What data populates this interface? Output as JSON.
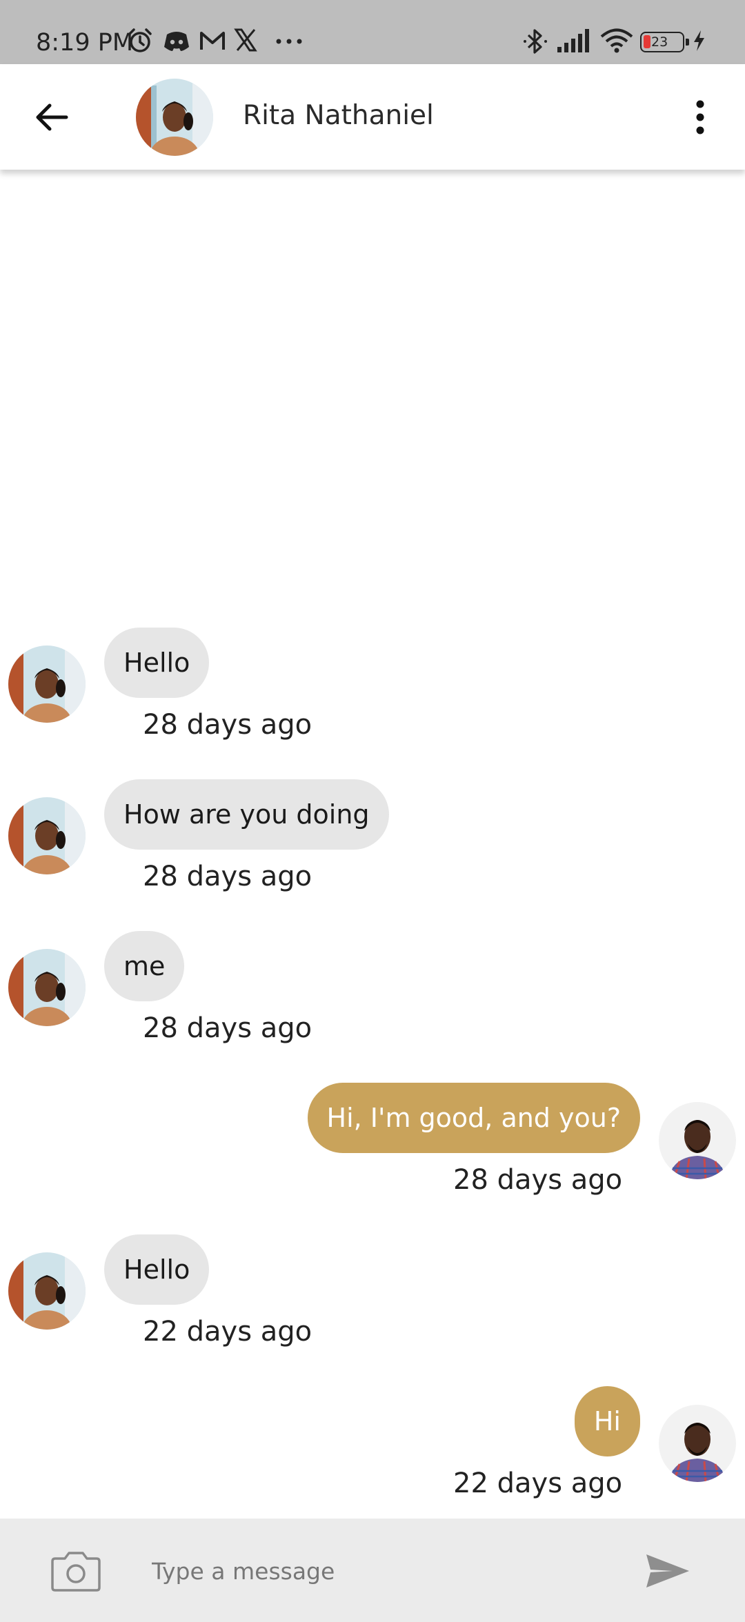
{
  "status_bar": {
    "time": "8:19 PM",
    "battery_level": "23",
    "left_icons": [
      "alarm-icon",
      "discord-icon",
      "gmail-icon",
      "x-icon",
      "more-notifications-icon"
    ],
    "right_icons": [
      "bluetooth-icon",
      "signal-icon",
      "wifi-icon",
      "battery-icon",
      "charging-icon"
    ]
  },
  "header": {
    "contact_name": "Rita Nathaniel",
    "back_icon": "arrow-left-icon",
    "menu_icon": "more-vertical-icon"
  },
  "messages": [
    {
      "direction": "incoming",
      "text": "Hello",
      "time": "28 days ago"
    },
    {
      "direction": "incoming",
      "text": "How are you doing",
      "time": "28 days ago"
    },
    {
      "direction": "incoming",
      "text": "me",
      "time": "28 days ago"
    },
    {
      "direction": "outgoing",
      "text": "Hi, I'm good, and you?",
      "time": "28 days ago"
    },
    {
      "direction": "incoming",
      "text": "Hello",
      "time": "22 days ago"
    },
    {
      "direction": "outgoing",
      "text": "Hi",
      "time": "22 days ago"
    }
  ],
  "composer": {
    "placeholder": "Type a message",
    "value": "",
    "camera_icon": "camera-icon",
    "send_icon": "send-icon"
  },
  "colors": {
    "outgoing_bubble": "#c9a35b",
    "incoming_bubble": "#e6e6e6",
    "status_bar": "#bdbdbd",
    "composer": "#ebebeb"
  }
}
